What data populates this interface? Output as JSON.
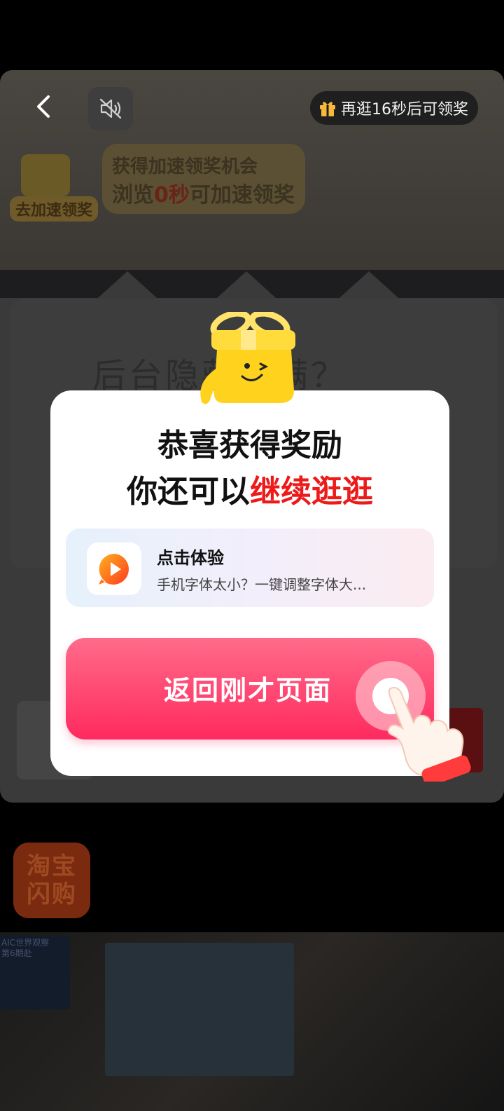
{
  "topbar": {
    "reward_text": "再逛16秒后可领奖"
  },
  "accelerate": {
    "line1": "获得加速领奖机会",
    "line2_prefix": "浏览",
    "line2_highlight": "0秒",
    "line2_suffix": "可加速领奖",
    "badge": "去加速领奖"
  },
  "background_card": {
    "text": "后台隐藏已满？"
  },
  "dialog": {
    "title_line1": "恭喜获得奖励",
    "title_line2_prefix": "你还可以",
    "title_line2_highlight": "继续逛逛",
    "promo": {
      "title": "点击体验",
      "description": "手机字体太小？一键调整字体大..."
    },
    "main_button": "返回刚才页面"
  },
  "shop_logo": {
    "line1": "淘宝",
    "line2": "闪购"
  },
  "video_poster_text": "AIC世界观察\n第6期赴",
  "colors": {
    "accent_red": "#ee1a1a",
    "button_pink": "#ff2a5f"
  },
  "icons": [
    "back-arrow-icon",
    "mute-icon",
    "gift-icon",
    "app-play-icon",
    "mascot-gift-icon",
    "pointing-hand-icon"
  ]
}
